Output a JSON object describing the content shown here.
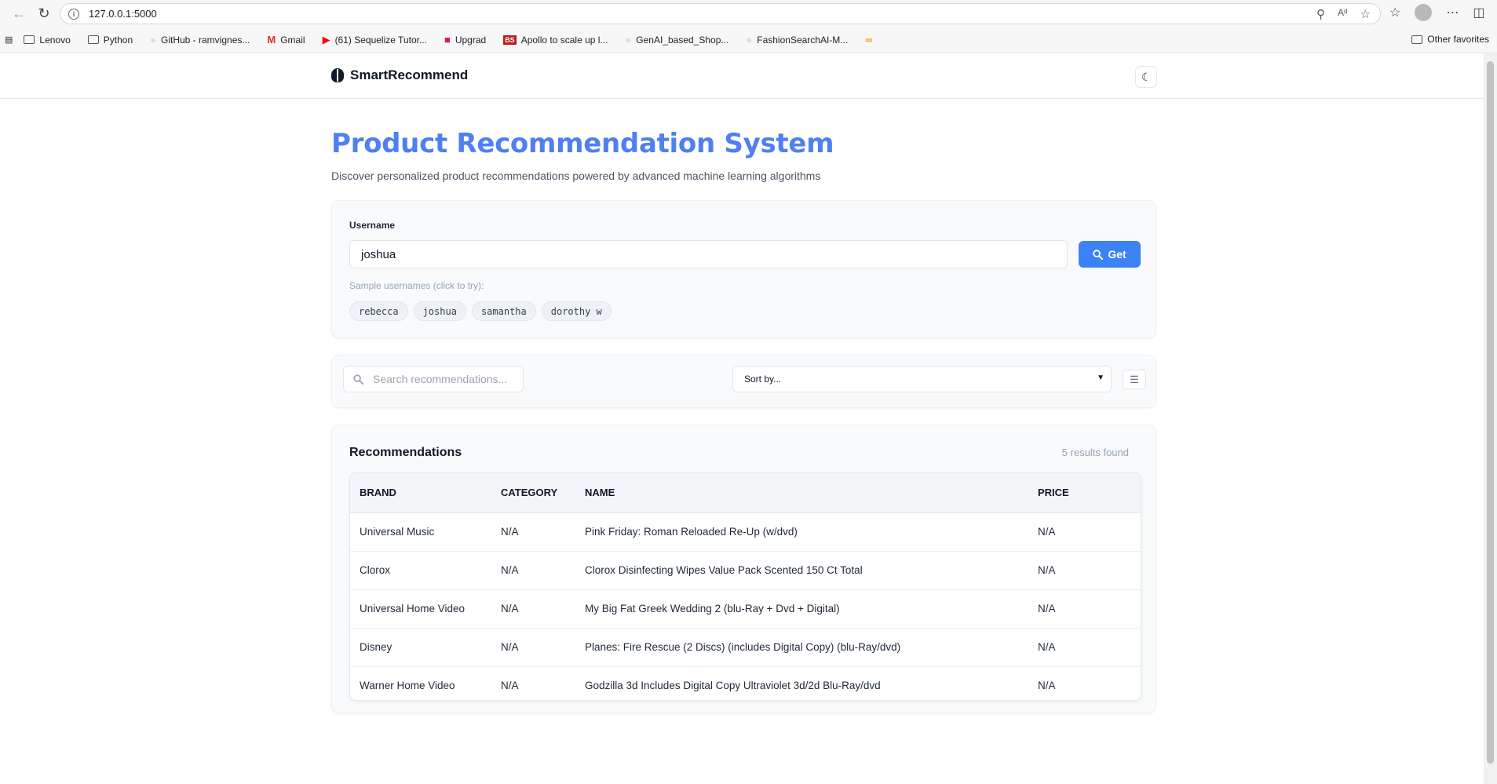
{
  "browser": {
    "url": "127.0.0.1:5000",
    "bookmarks": [
      {
        "label": "Lenovo",
        "icon": "folder-icon"
      },
      {
        "label": "Python",
        "icon": "folder-icon"
      },
      {
        "label": "GitHub - ramvignes...",
        "icon": "github-icon"
      },
      {
        "label": "Gmail",
        "icon": "gmail-icon"
      },
      {
        "label": "(61) Sequelize Tutor...",
        "icon": "youtube-icon"
      },
      {
        "label": "Upgrad",
        "icon": "upgrad-icon"
      },
      {
        "label": "Apollo to scale up l...",
        "icon": "bs-icon"
      },
      {
        "label": "GenAI_based_Shop...",
        "icon": "github-icon"
      },
      {
        "label": "FashionSearchAI-M...",
        "icon": "github-icon"
      }
    ],
    "other_favorites": "Other favorites"
  },
  "header": {
    "brand": "SmartRecommend",
    "theme_toggle_icon": "moon-icon"
  },
  "hero": {
    "title": "Product Recommendation System",
    "subtitle": "Discover personalized product recommendations powered by advanced machine learning algorithms"
  },
  "user_form": {
    "label": "Username",
    "value": "joshua",
    "button_label": "Get",
    "sample_label": "Sample usernames (click to try):",
    "samples": [
      "rebecca",
      "joshua",
      "samantha",
      "dorothy w"
    ]
  },
  "filter": {
    "search_placeholder": "Search recommendations...",
    "sort_value": "Sort by..."
  },
  "results": {
    "title": "Recommendations",
    "count": "5 results found",
    "columns": [
      "BRAND",
      "CATEGORY",
      "NAME",
      "PRICE"
    ],
    "rows": [
      {
        "brand": "Universal Music",
        "category": "N/A",
        "name": "Pink Friday: Roman Reloaded Re-Up (w/dvd)",
        "price": "N/A"
      },
      {
        "brand": "Clorox",
        "category": "N/A",
        "name": "Clorox Disinfecting Wipes Value Pack Scented 150 Ct Total",
        "price": "N/A"
      },
      {
        "brand": "Universal Home Video",
        "category": "N/A",
        "name": "My Big Fat Greek Wedding 2 (blu-Ray + Dvd + Digital)",
        "price": "N/A"
      },
      {
        "brand": "Disney",
        "category": "N/A",
        "name": "Planes: Fire Rescue (2 Discs) (includes Digital Copy) (blu-Ray/dvd)",
        "price": "N/A"
      },
      {
        "brand": "Warner Home Video",
        "category": "N/A",
        "name": "Godzilla 3d Includes Digital Copy Ultraviolet 3d/2d Blu-Ray/dvd",
        "price": "N/A"
      }
    ]
  },
  "colors": {
    "accent": "#3b82f6",
    "title": "#4f7ff0"
  }
}
